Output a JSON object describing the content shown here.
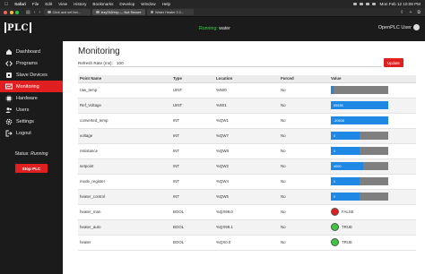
{
  "menubar": {
    "app": "Safari",
    "items": [
      "File",
      "Edit",
      "View",
      "History",
      "Bookmarks",
      "Develop",
      "Window",
      "Help"
    ],
    "clock": "Mon Feb 12  10:09 PM"
  },
  "browser": {
    "tabs": [
      {
        "label": "Click and set limi..."
      },
      {
        "label": "lezy318/xxp — Not Secure"
      },
      {
        "label": "Water Heater 2.0..."
      }
    ]
  },
  "header": {
    "logo_text": "PLC",
    "run_label": "Running:",
    "program_name": "water",
    "user_label": "OpenPLC User"
  },
  "sidebar": {
    "items": [
      {
        "label": "Dashboard",
        "icon": "home-icon"
      },
      {
        "label": "Programs",
        "icon": "code-icon"
      },
      {
        "label": "Slave Devices",
        "icon": "device-icon"
      },
      {
        "label": "Monitoring",
        "icon": "monitor-icon",
        "active": true
      },
      {
        "label": "Hardware",
        "icon": "chip-icon"
      },
      {
        "label": "Users",
        "icon": "users-icon"
      },
      {
        "label": "Settings",
        "icon": "gear-icon"
      },
      {
        "label": "Logout",
        "icon": "logout-icon"
      }
    ],
    "status_label": "Status:",
    "status_value": "Running",
    "stop_label": "Stop PLC"
  },
  "main": {
    "title": "Monitoring",
    "refresh_label": "Refresh Rate (ms):",
    "refresh_value": "100",
    "update_label": "Update",
    "columns": [
      "Point Name",
      "Type",
      "Location",
      "Forced",
      "Value"
    ],
    "rows": [
      {
        "name": "raw_temp",
        "type": "UINT",
        "location": "%IW0",
        "forced": "No",
        "kind": "bar",
        "fill": 0.05,
        "text": ""
      },
      {
        "name": "Ref_Voltage",
        "type": "UINT",
        "location": "%IW1",
        "forced": "No",
        "kind": "bar",
        "fill": 1.0,
        "text": "65535"
      },
      {
        "name": "converted_temp",
        "type": "INT",
        "location": "%QW1",
        "forced": "No",
        "kind": "bar",
        "fill": 1.0,
        "text": "-20608"
      },
      {
        "name": "voltage",
        "type": "INT",
        "location": "%QW7",
        "forced": "No",
        "kind": "bar",
        "fill": 0.5,
        "text": "0"
      },
      {
        "name": "resistance",
        "type": "INT",
        "location": "%QW8",
        "forced": "No",
        "kind": "bar",
        "fill": 0.5,
        "text": "0"
      },
      {
        "name": "setpoint",
        "type": "INT",
        "location": "%QW2",
        "forced": "No",
        "kind": "bar",
        "fill": 0.56,
        "text": "4000"
      },
      {
        "name": "mode_register",
        "type": "INT",
        "location": "%QW4",
        "forced": "No",
        "kind": "bar",
        "fill": 0.5,
        "text": "0"
      },
      {
        "name": "heater_control",
        "type": "INT",
        "location": "%QW5",
        "forced": "No",
        "kind": "bar",
        "fill": 0.5,
        "text": "0"
      },
      {
        "name": "heater_man",
        "type": "BOOL",
        "location": "%QX99.0",
        "forced": "No",
        "kind": "bool",
        "state": false,
        "text": "FALSE"
      },
      {
        "name": "heater_auto",
        "type": "BOOL",
        "location": "%QX99.1",
        "forced": "No",
        "kind": "bool",
        "state": true,
        "text": "TRUE"
      },
      {
        "name": "heater",
        "type": "BOOL",
        "location": "%QX0.0",
        "forced": "No",
        "kind": "bool",
        "state": true,
        "text": "TRUE"
      }
    ]
  },
  "colors": {
    "accent": "#e02020",
    "bar_fill": "#1f88e5",
    "bar_bg": "#7f7f7f",
    "lamp_on": "#3ec63e",
    "lamp_off": "#e02020",
    "running": "#3ad34a"
  }
}
